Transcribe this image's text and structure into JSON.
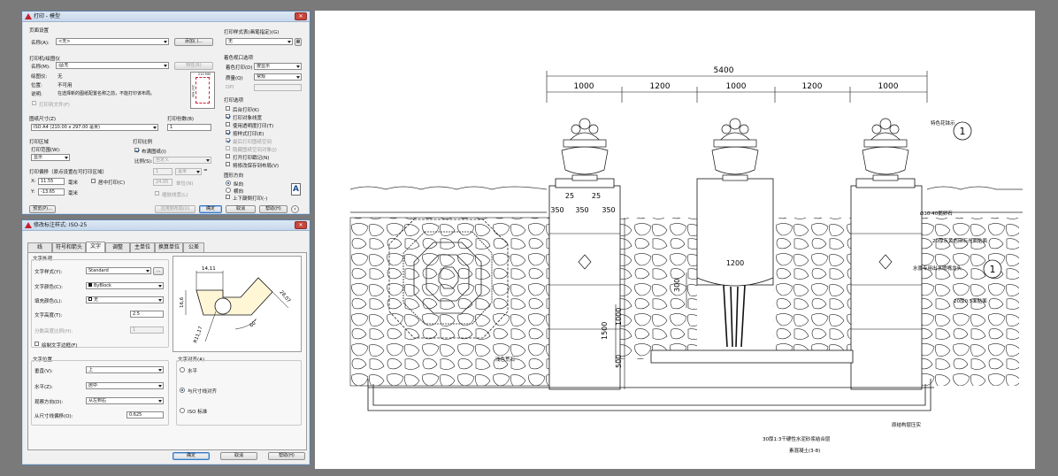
{
  "print_dialog": {
    "title": "打印 - 模型",
    "page_setup": {
      "section": "页面设置",
      "name_label": "名称(A):",
      "name_value": "<无>",
      "add_button": "添加(.)..."
    },
    "printer": {
      "section": "打印机/绘图仪",
      "name_label": "名称(M):",
      "name_value": "无",
      "properties_button": "特性(R)",
      "plotter_label": "绘图仪:",
      "plotter_value": "无",
      "location_label": "位置:",
      "location_value": "不可用",
      "desc_label": "说明:",
      "desc_value": "在选择新的图纸配置名称之前，不能打印该布局。",
      "print_to_file": "打印到文件(F)",
      "preview_dim_w": "210 MM",
      "preview_dim_h": "297 MM"
    },
    "paper_size": {
      "section": "图纸尺寸(Z)",
      "value": "ISO A4 (210.00 x 297.00 毫米)"
    },
    "copies": {
      "label": "打印份数(B)",
      "value": "1"
    },
    "print_area": {
      "section": "打印区域",
      "range_label": "打印范围(W):",
      "range_value": "显示"
    },
    "print_offset": {
      "section": "打印偏移（原点设置在可打印区域）",
      "x_label": "X:",
      "x_value": "11.55",
      "x_unit": "毫米",
      "y_label": "Y:",
      "y_value": "-13.65",
      "y_unit": "毫米",
      "center": "居中打印(C)"
    },
    "print_scale": {
      "section": "打印比例",
      "fit": "布满图纸(I)",
      "scale_label": "比例(S):",
      "scale_value": "自定义",
      "value1": "1",
      "unit1": "毫米",
      "value2": "24.05",
      "unit2": "单位(N)",
      "lineweights": "缩放线宽(L)"
    },
    "plot_style": {
      "section": "打印样式表(画笔指定)(G)",
      "value": "无"
    },
    "shaded_viewport": {
      "section": "着色视口选项",
      "shade_label": "着色打印(D)",
      "shade_value": "按显示",
      "quality_label": "质量(Q)",
      "quality_value": "常规",
      "dpi_label": "DPI"
    },
    "plot_options": {
      "section": "打印选项",
      "items": [
        {
          "label": "后台打印(K)",
          "checked": false,
          "enabled": true
        },
        {
          "label": "打印对象线宽",
          "checked": true,
          "enabled": true
        },
        {
          "label": "使用透明度打印(T)",
          "checked": false,
          "enabled": true
        },
        {
          "label": "按样式打印(E)",
          "checked": true,
          "enabled": true
        },
        {
          "label": "最后打印图纸空间",
          "checked": true,
          "enabled": false
        },
        {
          "label": "隐藏图纸空间对象(J)",
          "checked": false,
          "enabled": false
        },
        {
          "label": "打开打印戳记(N)",
          "checked": false,
          "enabled": true
        },
        {
          "label": "将修改保存到布局(V)",
          "checked": false,
          "enabled": true
        }
      ]
    },
    "orientation": {
      "section": "图形方向",
      "items": [
        {
          "label": "纵向",
          "selected": true
        },
        {
          "label": "横向",
          "selected": false
        }
      ],
      "upside_down": "上下颠倒打印(-)"
    },
    "buttons": {
      "preview": "预览(P)...",
      "apply_layout": "应用到布局(U)",
      "ok": "确定",
      "cancel": "取消",
      "help": "帮助(H)"
    }
  },
  "dim_dialog": {
    "title": "修改标注样式: ISO-25",
    "tabs": [
      "线",
      "符号和箭头",
      "文字",
      "调整",
      "主单位",
      "换算单位",
      "公差"
    ],
    "active_tab": 2,
    "text_appearance": {
      "section": "文字外观",
      "style_label": "文字样式(Y):",
      "style_value": "Standard",
      "color_label": "文字颜色(C):",
      "color_value": "ByBlock",
      "fill_label": "填充颜色(L):",
      "fill_value": "无",
      "height_label": "文字高度(T):",
      "height_value": "2.5",
      "fraction_label": "分数高度比例(H):",
      "fraction_value": "1",
      "frame_label": "绘制文字边框(F)"
    },
    "text_placement": {
      "section": "文字位置",
      "vertical_label": "垂直(V):",
      "vertical_value": "上",
      "horizontal_label": "水平(Z):",
      "horizontal_value": "居中",
      "view_label": "观察方向(D):",
      "view_value": "从左到右",
      "offset_label": "从尺寸线偏移(O):",
      "offset_value": "0.625"
    },
    "text_alignment": {
      "section": "文字对齐(A)",
      "options": [
        {
          "label": "水平",
          "selected": false
        },
        {
          "label": "与尺寸线对齐",
          "selected": true
        },
        {
          "label": "ISO 标准",
          "selected": false
        }
      ]
    },
    "preview": {
      "d1": "14,11",
      "d2": "16,6",
      "d3": "28,07",
      "d4": "60°",
      "d5": "R11,17"
    },
    "buttons": {
      "ok": "确定",
      "cancel": "取消",
      "help": "帮助(H)"
    }
  },
  "drawing": {
    "overall_dim": "5400",
    "bay_dims": [
      "1000",
      "1200",
      "1000",
      "1200",
      "1000"
    ],
    "pier_dims": [
      "350",
      "350",
      "350"
    ],
    "pot_dims": [
      "25",
      "25"
    ],
    "basin_dim": "1200",
    "vertical_dims": [
      "300",
      "1000",
      "1500",
      "500"
    ],
    "annotations": [
      "特色花钵示",
      "Ø30-40鹅卵石",
      "20厚灰黄色麻石光面贴面",
      "水景专用出水喷嘴龙头",
      "20厚0.5面贴面",
      "浅色荒石",
      "原结构层压实",
      "30厚1:3干硬性水泥砂浆结合层",
      "素混凝土(3-8)"
    ],
    "callouts": [
      "1",
      "1"
    ]
  }
}
